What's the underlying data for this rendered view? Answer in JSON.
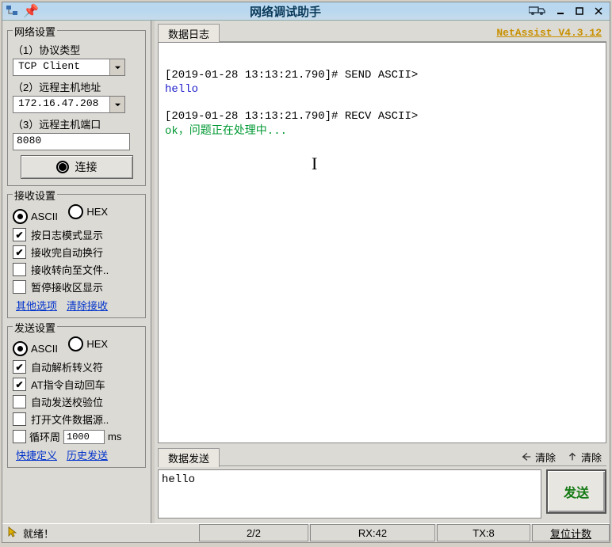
{
  "titlebar": {
    "title": "网络调试助手"
  },
  "version_link": "NetAssist V4.3.12",
  "network": {
    "legend": "网络设置",
    "proto_label": "（1）协议类型",
    "proto_value": "TCP Client",
    "host_label": "（2）远程主机地址",
    "host_value": "172.16.47.208",
    "port_label": "（3）远程主机端口",
    "port_value": "8080",
    "connect": "连接"
  },
  "recv": {
    "legend": "接收设置",
    "ascii": "ASCII",
    "hex": "HEX",
    "opt_logmode": "按日志模式显示",
    "opt_autowrap": "接收完自动换行",
    "opt_tofile": "接收转向至文件..",
    "opt_pause": "暂停接收区显示",
    "link_other": "其他选项",
    "link_clear": "清除接收"
  },
  "send": {
    "legend": "发送设置",
    "ascii": "ASCII",
    "hex": "HEX",
    "opt_escape": "自动解析转义符",
    "opt_atreturn": "AT指令自动回车",
    "opt_checksum": "自动发送校验位",
    "opt_opensrc": "打开文件数据源..",
    "cycle_label": "循环周",
    "cycle_value": "1000",
    "cycle_unit": "ms",
    "link_quick": "快捷定义",
    "link_history": "历史发送"
  },
  "log": {
    "tab": "数据日志",
    "line1": "[2019-01-28 13:13:21.790]# SEND ASCII>",
    "line2": "hello",
    "line3": "[2019-01-28 13:13:21.790]# RECV ASCII>",
    "line4": "ok，问题正在处理中..."
  },
  "sendarea": {
    "tab": "数据发送",
    "clear1": "清除",
    "clear2": "清除",
    "text": "hello",
    "button": "发送"
  },
  "status": {
    "ready": "就绪！",
    "ratio": "2/2",
    "rx": "RX:42",
    "tx": "TX:8",
    "reset": "复位计数"
  }
}
